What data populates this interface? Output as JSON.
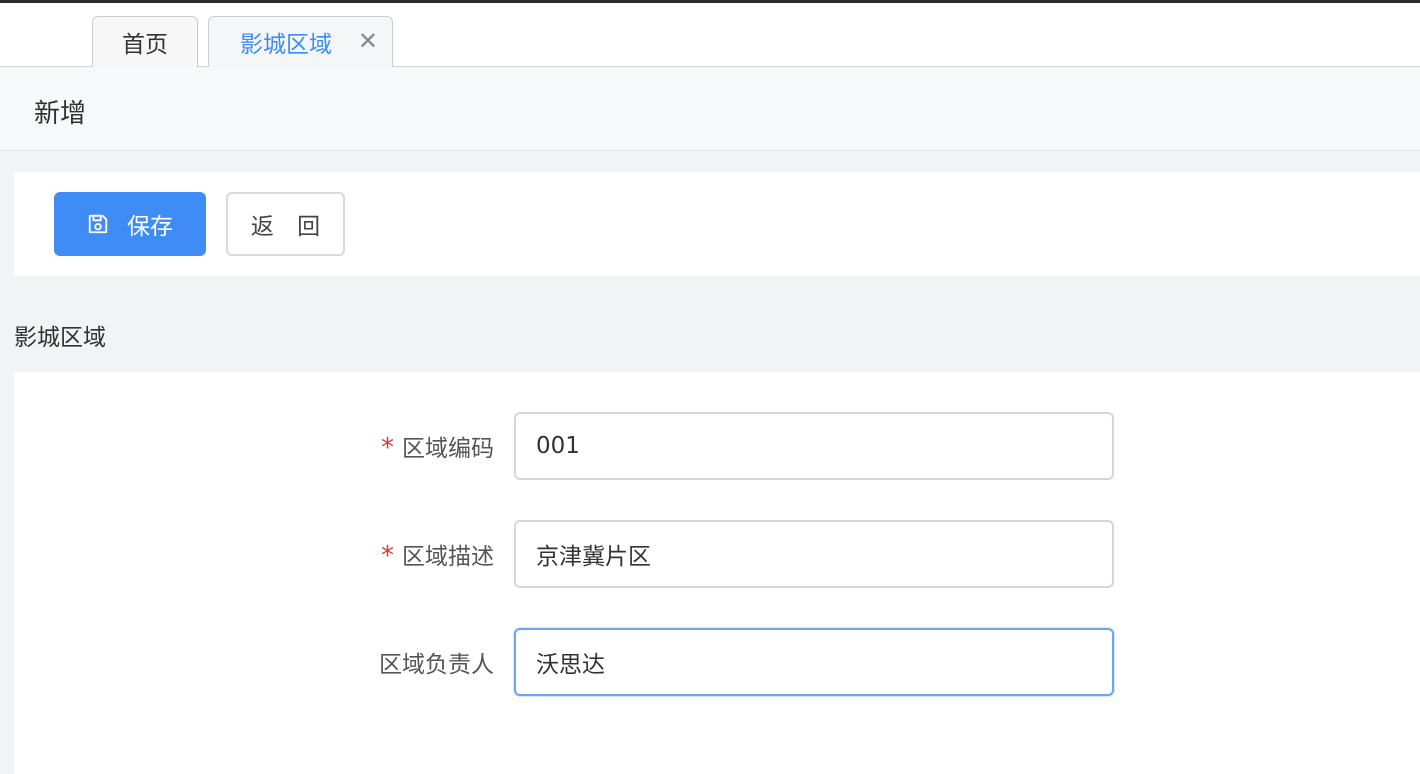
{
  "tabs": [
    {
      "label": "首页",
      "active": false
    },
    {
      "label": "影城区域",
      "active": true,
      "close_icon": "✕"
    }
  ],
  "page": {
    "title": "新增"
  },
  "toolbar": {
    "save_label": "保存",
    "save_icon": "save-icon",
    "back_label": "返 回"
  },
  "section": {
    "title": "影城区域"
  },
  "form": {
    "fields": [
      {
        "label": "区域编码",
        "required": true,
        "value": "001"
      },
      {
        "label": "区域描述",
        "required": true,
        "value": "京津冀片区"
      },
      {
        "label": "区域负责人",
        "required": false,
        "value": "沃思达",
        "focused": true
      }
    ],
    "required_mark": "*"
  },
  "colors": {
    "accent": "#3f8cf7",
    "required": "#e0362c",
    "active_tab": "#3d8df5"
  }
}
